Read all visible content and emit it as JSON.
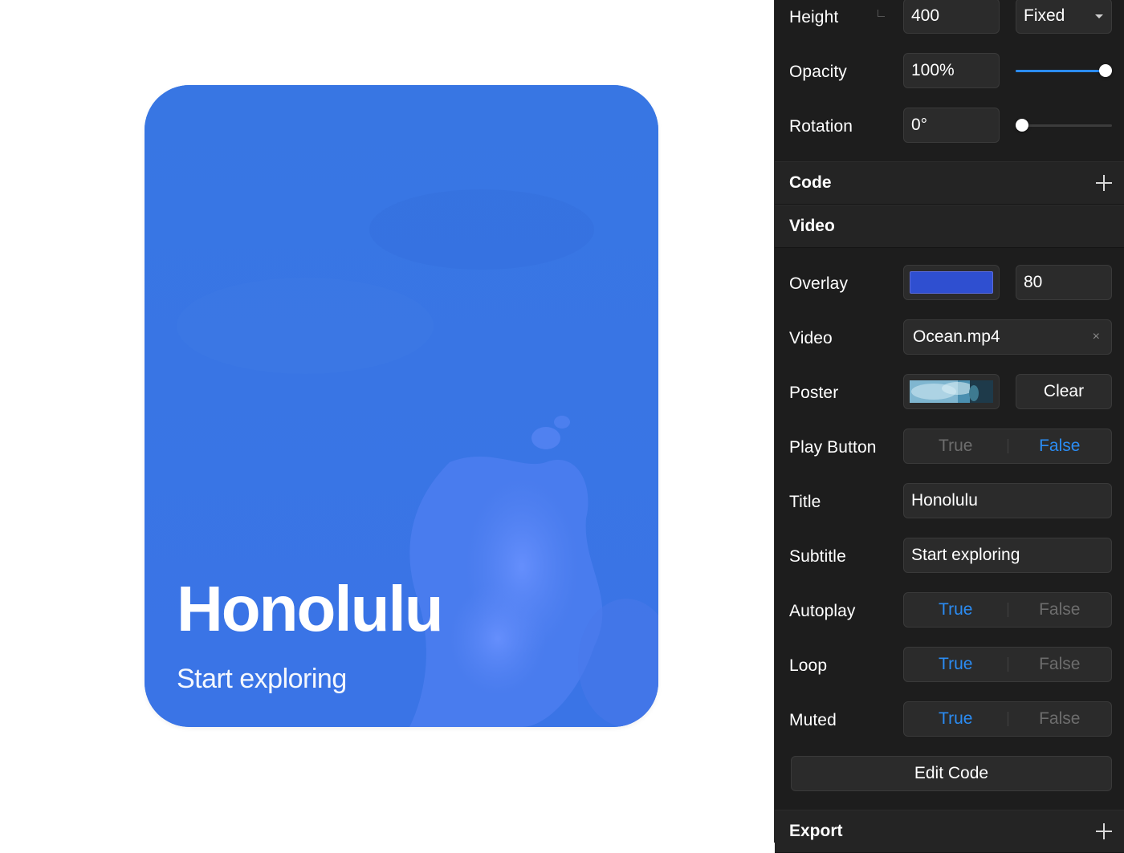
{
  "canvas": {
    "card": {
      "title": "Honolulu",
      "subtitle": "Start exploring",
      "overlay_color": "#3474e0"
    }
  },
  "panel": {
    "height": {
      "label": "Height",
      "value": "400",
      "mode": "Fixed"
    },
    "opacity": {
      "label": "Opacity",
      "value": "100%",
      "slider_fraction": 1.0
    },
    "rotation": {
      "label": "Rotation",
      "value": "0°",
      "slider_fraction": 0.0
    },
    "sections": {
      "code": "Code",
      "video": "Video",
      "export": "Export"
    },
    "overlay": {
      "label": "Overlay",
      "color": "#2f4fd0",
      "amount": "80"
    },
    "video": {
      "label": "Video",
      "file": "Ocean.mp4",
      "clear_icon": "×"
    },
    "poster": {
      "label": "Poster",
      "clear_label": "Clear"
    },
    "play_button": {
      "label": "Play Button",
      "true_label": "True",
      "false_label": "False",
      "selected": "False"
    },
    "title": {
      "label": "Title",
      "value": "Honolulu"
    },
    "subtitle": {
      "label": "Subtitle",
      "value": "Start exploring"
    },
    "autoplay": {
      "label": "Autoplay",
      "true_label": "True",
      "false_label": "False",
      "selected": "True"
    },
    "loop": {
      "label": "Loop",
      "true_label": "True",
      "false_label": "False",
      "selected": "True"
    },
    "muted": {
      "label": "Muted",
      "true_label": "True",
      "false_label": "False",
      "selected": "True"
    },
    "edit_code_label": "Edit Code",
    "accent": "#2b8cf3"
  }
}
